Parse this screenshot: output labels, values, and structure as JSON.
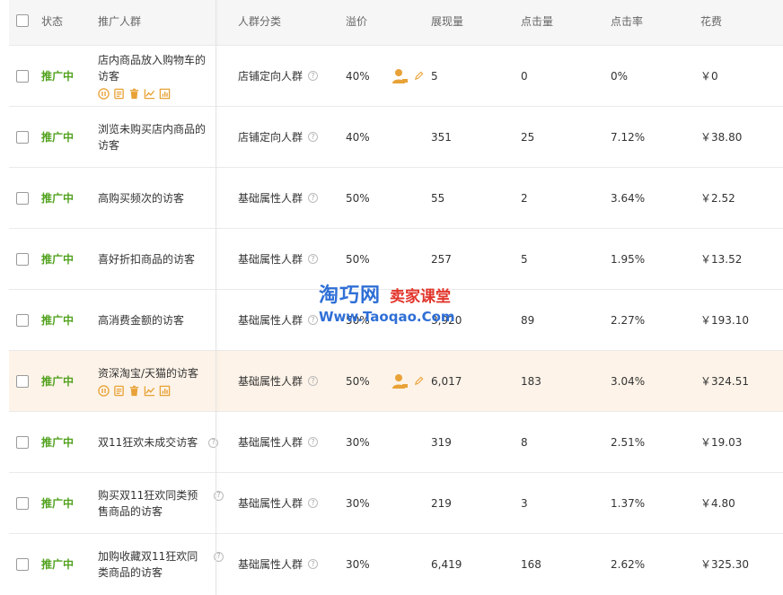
{
  "header": {
    "status": "状态",
    "name": "推广人群",
    "category": "人群分类",
    "premium": "溢价",
    "impressions": "展现量",
    "clicks": "点击量",
    "ctr": "点击率",
    "cost": "花费"
  },
  "rows": [
    {
      "status": "推广中",
      "name": "店内商品放入购物车的访客",
      "category": "店铺定向人群",
      "premium": "40%",
      "impressions": "5",
      "clicks": "0",
      "ctr": "0%",
      "cost": "￥0"
    },
    {
      "status": "推广中",
      "name": "浏览未购买店内商品的访客",
      "category": "店铺定向人群",
      "premium": "40%",
      "impressions": "351",
      "clicks": "25",
      "ctr": "7.12%",
      "cost": "￥38.80"
    },
    {
      "status": "推广中",
      "name": "高购买频次的访客",
      "category": "基础属性人群",
      "premium": "50%",
      "impressions": "55",
      "clicks": "2",
      "ctr": "3.64%",
      "cost": "￥2.52"
    },
    {
      "status": "推广中",
      "name": "喜好折扣商品的访客",
      "category": "基础属性人群",
      "premium": "50%",
      "impressions": "257",
      "clicks": "5",
      "ctr": "1.95%",
      "cost": "￥13.52"
    },
    {
      "status": "推广中",
      "name": "高消费金额的访客",
      "category": "基础属性人群",
      "premium": "50%",
      "impressions": "3,920",
      "clicks": "89",
      "ctr": "2.27%",
      "cost": "￥193.10"
    },
    {
      "status": "推广中",
      "name": "资深淘宝/天猫的访客",
      "category": "基础属性人群",
      "premium": "50%",
      "impressions": "6,017",
      "clicks": "183",
      "ctr": "3.04%",
      "cost": "￥324.51"
    },
    {
      "status": "推广中",
      "name": "双11狂欢未成交访客",
      "category": "基础属性人群",
      "premium": "30%",
      "impressions": "319",
      "clicks": "8",
      "ctr": "2.51%",
      "cost": "￥19.03"
    },
    {
      "status": "推广中",
      "name": "购买双11狂欢同类预售商品的访客",
      "category": "基础属性人群",
      "premium": "30%",
      "impressions": "219",
      "clicks": "3",
      "ctr": "1.37%",
      "cost": "￥4.80"
    },
    {
      "status": "推广中",
      "name": "加购收藏双11狂欢同类商品的访客",
      "category": "基础属性人群",
      "premium": "30%",
      "impressions": "6,419",
      "clicks": "168",
      "ctr": "2.62%",
      "cost": "￥325.30"
    }
  ],
  "colors": {
    "status_green": "#52a21f",
    "icon_orange": "#e8a237",
    "highlight_row": "#fdf3e8",
    "header_bg": "#f6f6f6"
  },
  "watermark": {
    "site": "淘巧网",
    "slogan": "卖家课堂",
    "url": "Www.Taoqao.Com"
  }
}
